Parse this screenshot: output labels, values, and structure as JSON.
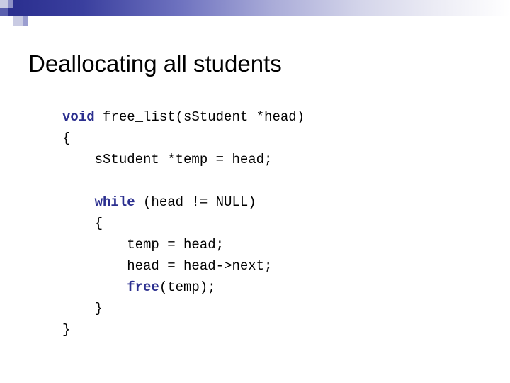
{
  "slide": {
    "title": "Deallocating all students",
    "decoration": {
      "band_colors": [
        "#2b2f8f",
        "#9b9ed0",
        "#c9cbe3",
        "#ffffff"
      ]
    },
    "code": {
      "lines": [
        {
          "indent": 0,
          "keyword": "void",
          "rest": " free_list(sStudent *head)"
        },
        {
          "indent": 0,
          "keyword": "",
          "rest": "{"
        },
        {
          "indent": 1,
          "keyword": "",
          "rest": "sStudent *temp = head;"
        },
        {
          "indent": 0,
          "keyword": "",
          "rest": ""
        },
        {
          "indent": 1,
          "keyword": "while",
          "rest": " (head != NULL)"
        },
        {
          "indent": 1,
          "keyword": "",
          "rest": "{"
        },
        {
          "indent": 2,
          "keyword": "",
          "rest": "temp = head;"
        },
        {
          "indent": 2,
          "keyword": "",
          "rest": "head = head->next;"
        },
        {
          "indent": 2,
          "keyword": "free",
          "rest": "(temp);"
        },
        {
          "indent": 1,
          "keyword": "",
          "rest": "}"
        },
        {
          "indent": 0,
          "keyword": "",
          "rest": "}"
        }
      ]
    }
  }
}
